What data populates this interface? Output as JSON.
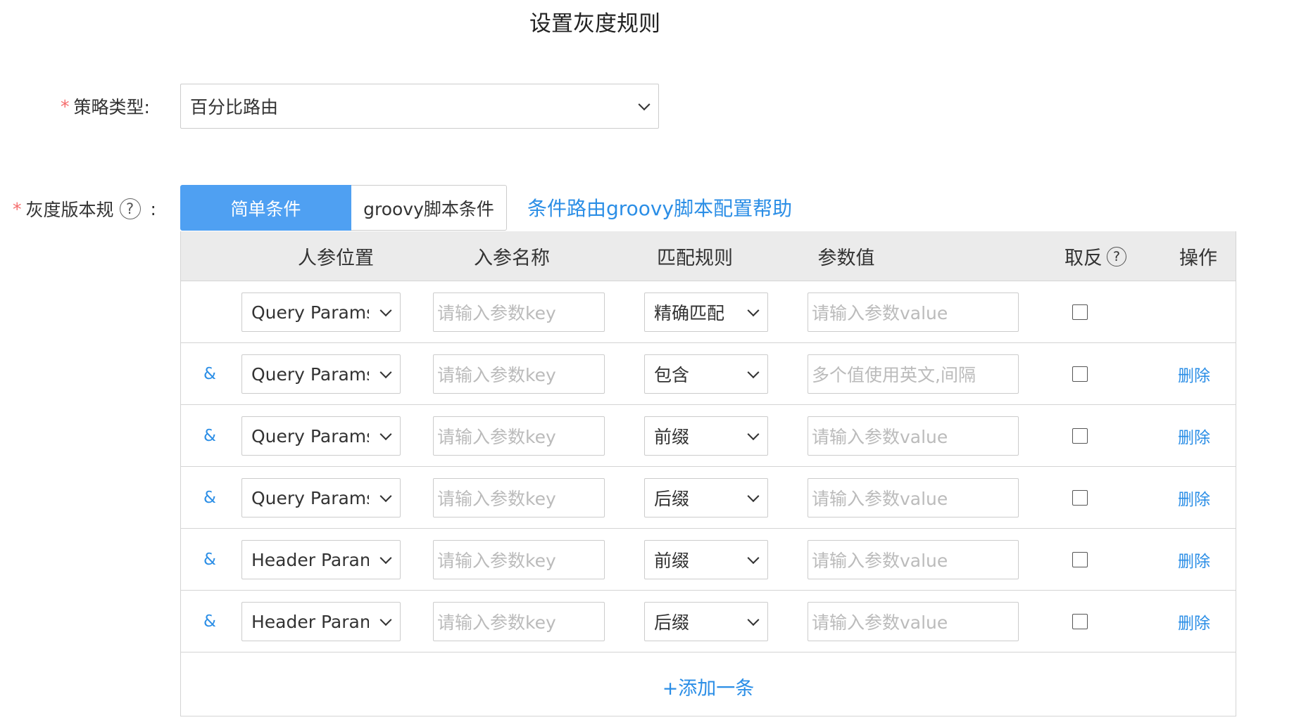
{
  "page": {
    "title": "设置灰度规则"
  },
  "strategy": {
    "required_mark": "*",
    "label": "策略类型:",
    "value": "百分比路由"
  },
  "rule": {
    "required_mark": "*",
    "label": "灰度版本规",
    "help": "?",
    "colon": ":",
    "tabs": [
      {
        "label": "简单条件",
        "active": true
      },
      {
        "label": "groovy脚本条件",
        "active": false
      }
    ],
    "help_link": "条件路由groovy脚本配置帮助"
  },
  "table": {
    "headers": {
      "position": "人参位置",
      "name": "入参名称",
      "rule": "匹配规则",
      "value": "参数值",
      "invert": "取反",
      "invert_help": "?",
      "ops": "操作"
    },
    "rows": [
      {
        "connector": "",
        "param_location": "Query Params",
        "key_placeholder": "请输入参数key",
        "match_rule": "精确匹配",
        "value_placeholder": "请输入参数value",
        "inverted": false,
        "action": ""
      },
      {
        "connector": "&",
        "param_location": "Query Params",
        "key_placeholder": "请输入参数key",
        "match_rule": "包含",
        "value_placeholder": "多个值使用英文,间隔",
        "inverted": false,
        "action": "删除"
      },
      {
        "connector": "&",
        "param_location": "Query Params",
        "key_placeholder": "请输入参数key",
        "match_rule": "前缀",
        "value_placeholder": "请输入参数value",
        "inverted": false,
        "action": "删除"
      },
      {
        "connector": "&",
        "param_location": "Query Params",
        "key_placeholder": "请输入参数key",
        "match_rule": "后缀",
        "value_placeholder": "请输入参数value",
        "inverted": false,
        "action": "删除"
      },
      {
        "connector": "&",
        "param_location": "Header Params",
        "key_placeholder": "请输入参数key",
        "match_rule": "前缀",
        "value_placeholder": "请输入参数value",
        "inverted": false,
        "action": "删除"
      },
      {
        "connector": "&",
        "param_location": "Header Params",
        "key_placeholder": "请输入参数key",
        "match_rule": "后缀",
        "value_placeholder": "请输入参数value",
        "inverted": false,
        "action": "删除"
      }
    ],
    "add_label": "+添加一条"
  },
  "colors": {
    "primary": "#4fa0f2",
    "link": "#2b8ee6",
    "required": "#f56c6c",
    "header_bg": "#ebebeb",
    "border": "#d4d4d4"
  }
}
